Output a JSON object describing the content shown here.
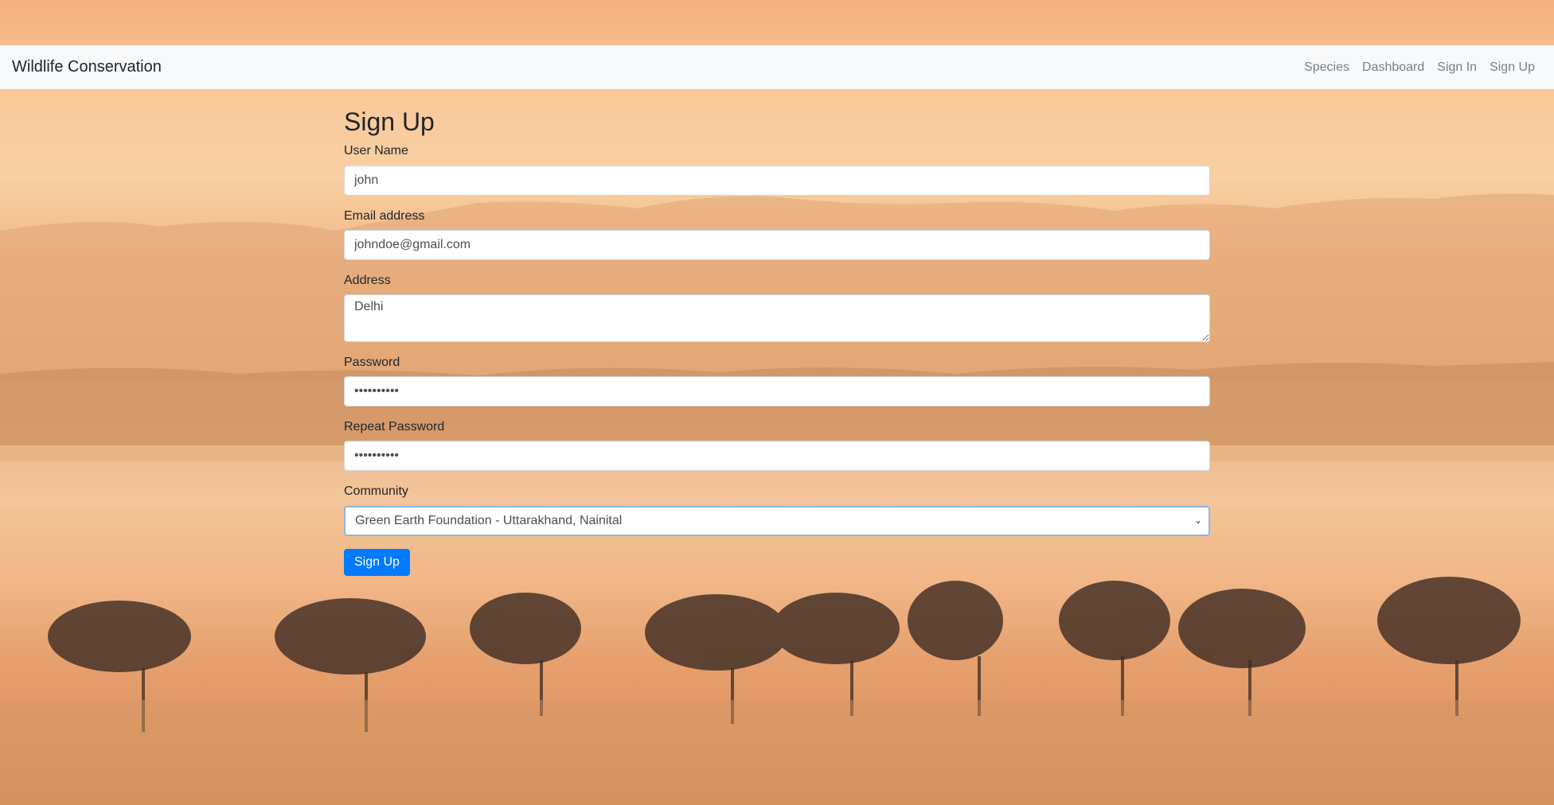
{
  "navbar": {
    "brand": "Wildlife Conservation",
    "links": [
      "Species",
      "Dashboard",
      "Sign In",
      "Sign Up"
    ]
  },
  "form": {
    "title": "Sign Up",
    "username": {
      "label": "User Name",
      "value": "john"
    },
    "email": {
      "label": "Email address",
      "value": "johndoe@gmail.com"
    },
    "address": {
      "label": "Address",
      "value": "Delhi"
    },
    "password": {
      "label": "Password",
      "value": "••••••••••"
    },
    "repeat_password": {
      "label": "Repeat Password",
      "value": "••••••••••"
    },
    "community": {
      "label": "Community",
      "selected": "Green Earth Foundation - Uttarakhand, Nainital"
    },
    "submit_label": "Sign Up"
  },
  "colors": {
    "primary": "#007bff",
    "navbar_bg": "#f8f9fa"
  },
  "icons": {
    "select": "chevron-down-icon"
  }
}
